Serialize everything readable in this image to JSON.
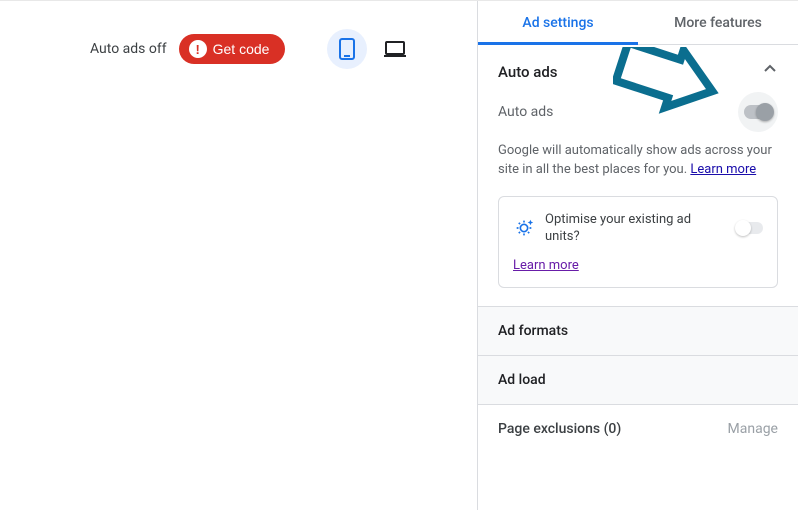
{
  "left": {
    "status": "Auto ads off",
    "get_code": "Get code"
  },
  "tabs": {
    "ad_settings": "Ad settings",
    "more_features": "More features"
  },
  "auto_ads": {
    "header": "Auto ads",
    "sub_label": "Auto ads",
    "desc_prefix": "Google will automatically show ads across your site in all the best places for you. ",
    "learn_more": "Learn more"
  },
  "card": {
    "question": "Optimise your existing ad units?",
    "learn_more": "Learn more"
  },
  "rows": {
    "ad_formats": "Ad formats",
    "ad_load": "Ad load",
    "page_exclusions": "Page exclusions (0)",
    "manage": "Manage"
  }
}
